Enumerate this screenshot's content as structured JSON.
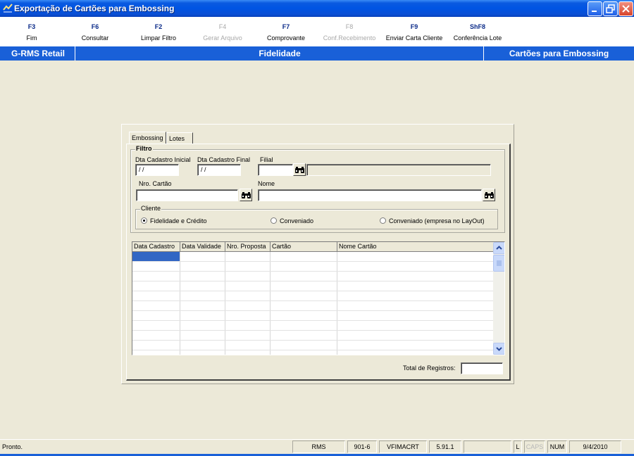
{
  "window": {
    "title": "Exportação de Cartões para Embossing"
  },
  "function_keys": [
    {
      "key": "F3",
      "label": "Fim",
      "enabled": true
    },
    {
      "key": "F6",
      "label": "Consultar",
      "enabled": true
    },
    {
      "key": "F2",
      "label": "Limpar Filtro",
      "enabled": true
    },
    {
      "key": "F4",
      "label": "Gerar Arquivo",
      "enabled": false
    },
    {
      "key": "F7",
      "label": "Comprovante",
      "enabled": true
    },
    {
      "key": "F8",
      "label": "Conf.Recebimento",
      "enabled": false
    },
    {
      "key": "F9",
      "label": "Enviar Carta Cliente",
      "enabled": true
    },
    {
      "key": "ShF8",
      "label": "Conferência Lote",
      "enabled": true
    }
  ],
  "header": {
    "left": "G-RMS Retail",
    "center": "Fidelidade",
    "right": "Cartões para Embossing"
  },
  "tabs": [
    {
      "label": "Embossing",
      "active": true
    },
    {
      "label": "Lotes",
      "active": false
    }
  ],
  "filtro": {
    "legend": "Filtro",
    "dta_cadastro_inicial": {
      "label": "Dta Cadastro Inicial",
      "value": " / /"
    },
    "dta_cadastro_final": {
      "label": "Dta Cadastro Final",
      "value": " / /"
    },
    "filial": {
      "label": "Filial",
      "value": "",
      "description": ""
    },
    "nro_cartao": {
      "label": "Nro. Cartão",
      "value": ""
    },
    "nome": {
      "label": "Nome",
      "value": ""
    },
    "cliente": {
      "legend": "Cliente",
      "options": [
        {
          "label": "Fidelidade e Crédito",
          "selected": true
        },
        {
          "label": "Conveniado",
          "selected": false
        },
        {
          "label": "Conveniado (empresa no LayOut)",
          "selected": false
        }
      ]
    }
  },
  "grid": {
    "columns": [
      "Data Cadastro",
      "Data Validade",
      "Nro. Proposta",
      "Cartão",
      "Nome Cartão"
    ],
    "rows": []
  },
  "total_registros": {
    "label": "Total de Registros:",
    "value": ""
  },
  "status_bar": {
    "message": "Pronto.",
    "panels": [
      "RMS",
      "901-6",
      "VFIMACRT",
      "5.91.1",
      "",
      "L",
      "CAPS",
      "NUM",
      "9/4/2010"
    ]
  },
  "colors": {
    "title_bar": "#0054e3",
    "header_bar": "#1960d8",
    "selection": "#3166c4",
    "fkey_text": "#0a2a88"
  }
}
